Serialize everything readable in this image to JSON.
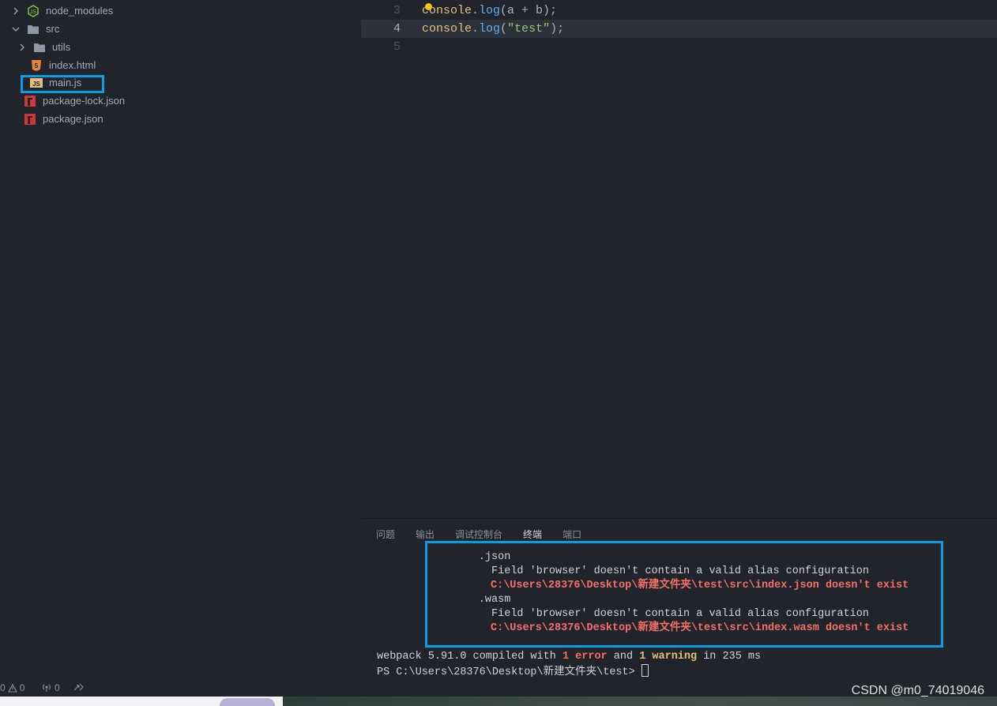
{
  "explorer": {
    "items": [
      {
        "label": "node_modules",
        "kind": "folder",
        "expanded": false
      },
      {
        "label": "src",
        "kind": "folder",
        "expanded": true
      },
      {
        "label": "utils",
        "kind": "folder",
        "expanded": false
      },
      {
        "label": "index.html",
        "kind": "html"
      },
      {
        "label": "main.js",
        "kind": "js",
        "icon_text": "JS"
      },
      {
        "label": "package-lock.json",
        "kind": "json"
      },
      {
        "label": "package.json",
        "kind": "json"
      }
    ]
  },
  "editor": {
    "lines": [
      {
        "num": "3",
        "tokens": [
          [
            "obj",
            "console"
          ],
          [
            "p",
            "."
          ],
          [
            "fn",
            "log"
          ],
          [
            "p",
            "(a + b);"
          ]
        ]
      },
      {
        "num": "4",
        "tokens": [
          [
            "obj",
            "console"
          ],
          [
            "p",
            "."
          ],
          [
            "fn",
            "log"
          ],
          [
            "p",
            "("
          ],
          [
            "str",
            "\"test\""
          ],
          [
            "p",
            ");"
          ]
        ]
      },
      {
        "num": "5",
        "tokens": []
      }
    ],
    "current_line": "4"
  },
  "panel": {
    "tabs": [
      "问题",
      "输出",
      "调试控制台",
      "终端",
      "端口"
    ],
    "active_tab": "终端",
    "terminal": {
      "l1": "        .json",
      "l2": "          Field 'browser' doesn't contain a valid alias configuration",
      "l3": "C:\\Users\\28376\\Desktop\\新建文件夹\\test\\src\\index.json doesn't exist",
      "l4": "        .wasm",
      "l5": "          Field 'browser' doesn't contain a valid alias configuration",
      "l6": "C:\\Users\\28376\\Desktop\\新建文件夹\\test\\src\\index.wasm doesn't exist",
      "summary_a": "webpack 5.91.0 compiled with ",
      "summary_err": "1 error",
      "summary_b": " and ",
      "summary_warn": "1 warning",
      "summary_c": " in 235 ms",
      "prompt": "PS C:\\Users\\28376\\Desktop\\新建文件夹\\test> "
    }
  },
  "statusbar": {
    "errors": "0",
    "warnings": "0",
    "ports": "0",
    "watermark": "CSDN @m0_74019046"
  },
  "colors": {
    "background": "#21252b",
    "highlight_border": "#0a9ee6",
    "error_text": "#f47067",
    "warning_text": "#e5c07b"
  }
}
